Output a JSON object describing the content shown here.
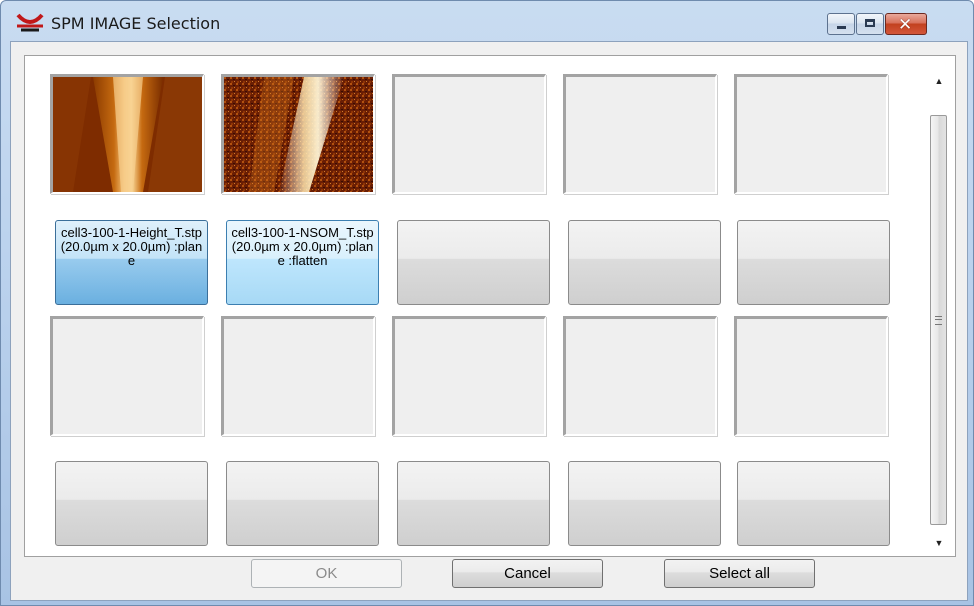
{
  "window": {
    "title": "SPM IMAGE Selection",
    "logo_icon": "spm-logo-icon",
    "controls": {
      "minimize_icon": "minimize-icon",
      "maximize_icon": "maximize-icon",
      "close_icon": "close-icon",
      "close_glyph": "✕"
    }
  },
  "grid": {
    "rows": [
      {
        "thumbnails": [
          "height-map-image",
          "nsom-map-image",
          "",
          "",
          ""
        ],
        "labels": [
          "cell3-100-1-Height_T.stp (20.0µm x 20.0µm) :plane",
          "cell3-100-1-NSOM_T.stp (20.0µm x 20.0µm) :plane :flatten",
          "",
          "",
          ""
        ],
        "selected": [
          true,
          true,
          false,
          false,
          false
        ]
      },
      {
        "thumbnails": [
          "",
          "",
          "",
          "",
          ""
        ],
        "labels": [
          "",
          "",
          "",
          "",
          ""
        ],
        "selected": [
          false,
          false,
          false,
          false,
          false
        ]
      }
    ]
  },
  "scrollbar": {
    "up_glyph": "▲",
    "down_glyph": "▼"
  },
  "buttons": {
    "ok": "OK",
    "cancel": "Cancel",
    "select_all": "Select all"
  },
  "colors": {
    "selected_dark": "#6bb0e0",
    "selected_light": "#bee6fd",
    "close_red": "#c2411f"
  }
}
